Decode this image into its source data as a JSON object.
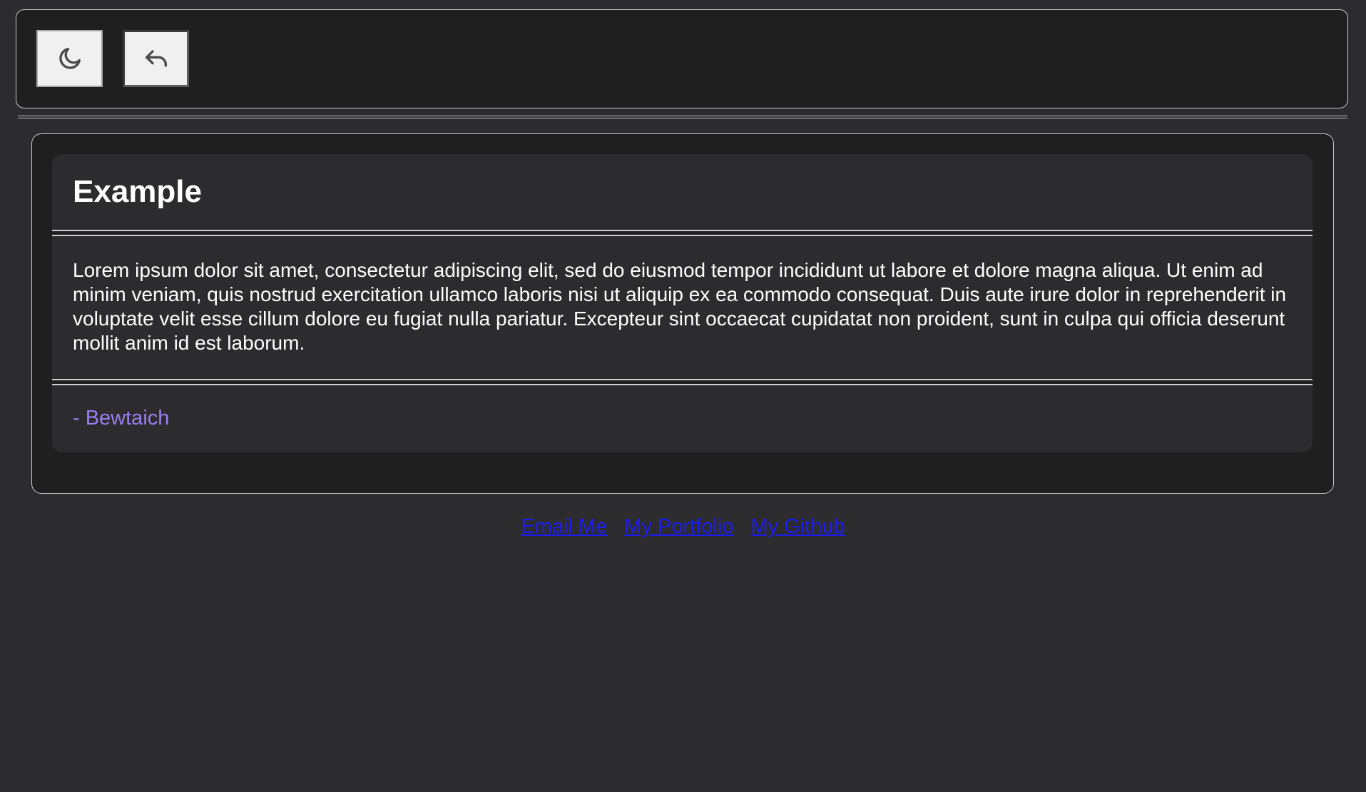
{
  "header": {
    "theme_toggle_icon": "moon-icon",
    "back_button_icon": "undo-arrow-icon"
  },
  "card": {
    "title": "Example",
    "body": "Lorem ipsum dolor sit amet, consectetur adipiscing elit, sed do eiusmod tempor incididunt ut labore et dolore magna aliqua. Ut enim ad minim veniam, quis nostrud exercitation ullamco laboris nisi ut aliquip ex ea commodo consequat. Duis aute irure dolor in reprehenderit in voluptate velit esse cillum dolore eu fugiat nulla pariatur. Excepteur sint occaecat cupidatat non proident, sunt in culpa qui officia deserunt mollit anim id est laborum.",
    "author": "- Bewtaich"
  },
  "footer": {
    "links": [
      {
        "label": "Email Me"
      },
      {
        "label": "My Portfolio"
      },
      {
        "label": "My Github"
      }
    ]
  },
  "colors": {
    "page_background": "#2c2c2f",
    "panel_background": "#1f1f1f",
    "author_accent": "#9b7ff2",
    "link": "#1d1cf0"
  }
}
